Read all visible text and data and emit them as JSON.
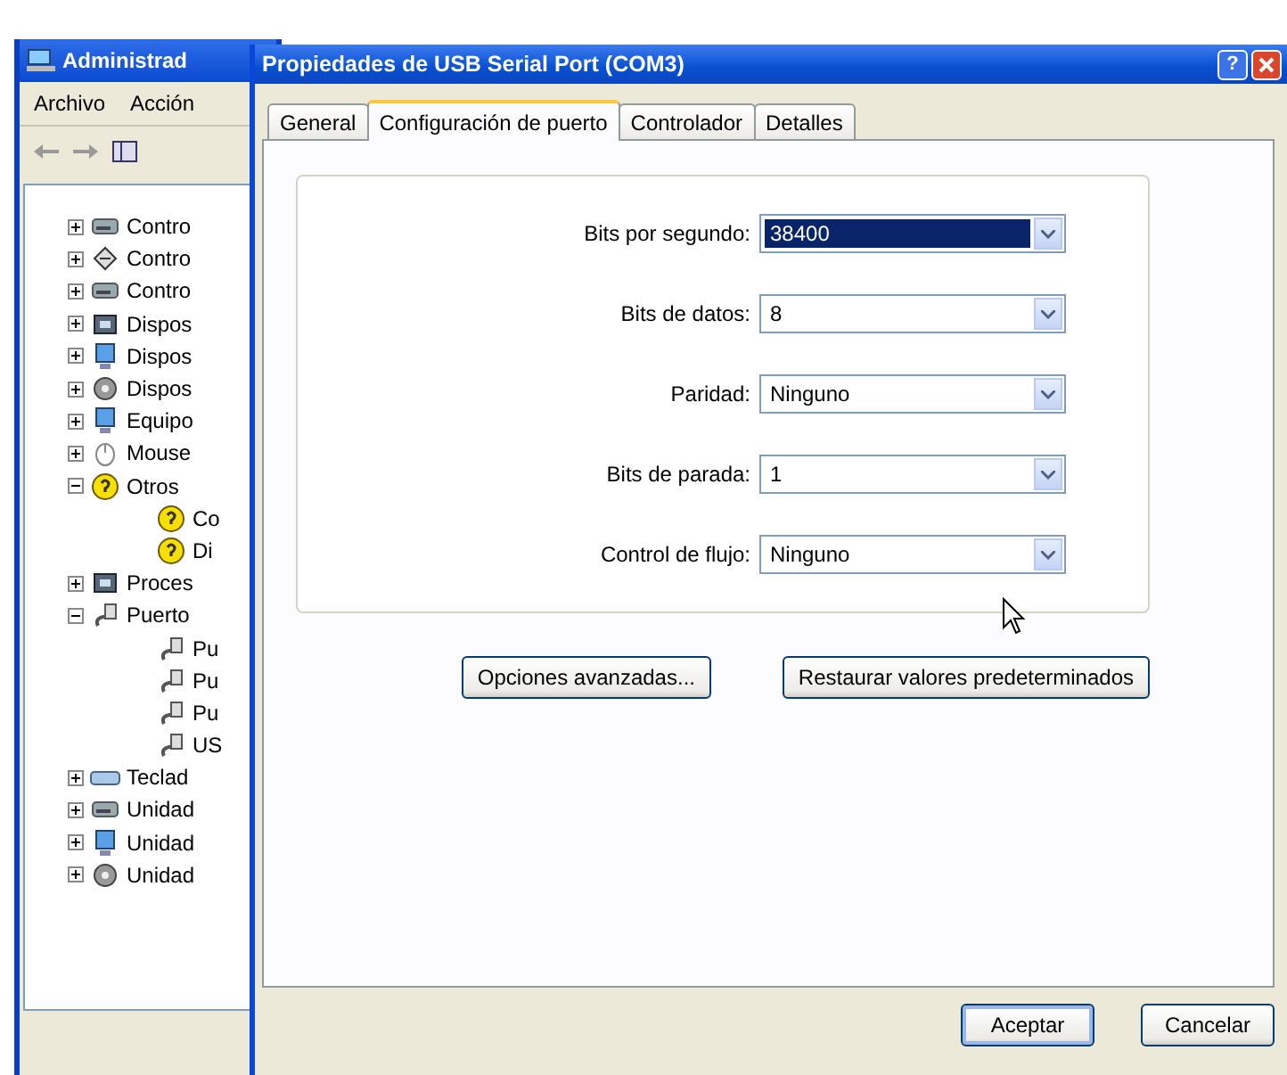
{
  "background_window": {
    "title": "Administrad",
    "menu": [
      "Archivo",
      "Acción"
    ],
    "tree": [
      {
        "label": "Contro",
        "kind": "drive",
        "expanded": false
      },
      {
        "label": "Contro",
        "kind": "network",
        "expanded": false
      },
      {
        "label": "Contro",
        "kind": "drive",
        "expanded": false
      },
      {
        "label": "Dispos",
        "kind": "chip",
        "expanded": false
      },
      {
        "label": "Dispos",
        "kind": "monitor",
        "expanded": false
      },
      {
        "label": "Dispos",
        "kind": "disc",
        "expanded": false
      },
      {
        "label": "Equipo",
        "kind": "monitor",
        "expanded": false
      },
      {
        "label": "Mouse",
        "kind": "mouse",
        "expanded": false
      },
      {
        "label": "Otros",
        "kind": "unknown",
        "expanded": true,
        "children": [
          {
            "label": "Co",
            "kind": "unknown"
          },
          {
            "label": "Di",
            "kind": "unknown"
          }
        ]
      },
      {
        "label": "Proces",
        "kind": "chip",
        "expanded": false
      },
      {
        "label": "Puerto",
        "kind": "port",
        "expanded": true,
        "children": [
          {
            "label": "Pu",
            "kind": "port"
          },
          {
            "label": "Pu",
            "kind": "port"
          },
          {
            "label": "Pu",
            "kind": "port"
          },
          {
            "label": "US",
            "kind": "port"
          }
        ]
      },
      {
        "label": "Teclad",
        "kind": "keyboard",
        "expanded": false
      },
      {
        "label": "Unidad",
        "kind": "drive",
        "expanded": false
      },
      {
        "label": "Unidad",
        "kind": "monitor",
        "expanded": false
      },
      {
        "label": "Unidad",
        "kind": "disc",
        "expanded": false
      }
    ]
  },
  "dialog": {
    "title": "Propiedades de USB Serial Port (COM3)",
    "help_button": "?",
    "tabs": [
      {
        "label": "General",
        "selected": false
      },
      {
        "label": "Configuración de puerto",
        "selected": true
      },
      {
        "label": "Controlador",
        "selected": false
      },
      {
        "label": "Detalles",
        "selected": false
      }
    ],
    "settings": [
      {
        "label": "Bits por segundo:",
        "value": "38400",
        "focused": true
      },
      {
        "label": "Bits de datos:",
        "value": "8",
        "focused": false
      },
      {
        "label": "Paridad:",
        "value": "Ninguno",
        "focused": false
      },
      {
        "label": "Bits de parada:",
        "value": "1",
        "focused": false
      },
      {
        "label": "Control de flujo:",
        "value": "Ninguno",
        "focused": false
      }
    ],
    "buttons": [
      "Opciones avanzadas...",
      "Restaurar valores predeterminados"
    ],
    "footer_buttons": [
      {
        "label": "Aceptar",
        "default": true
      },
      {
        "label": "Cancelar",
        "default": false
      }
    ]
  }
}
